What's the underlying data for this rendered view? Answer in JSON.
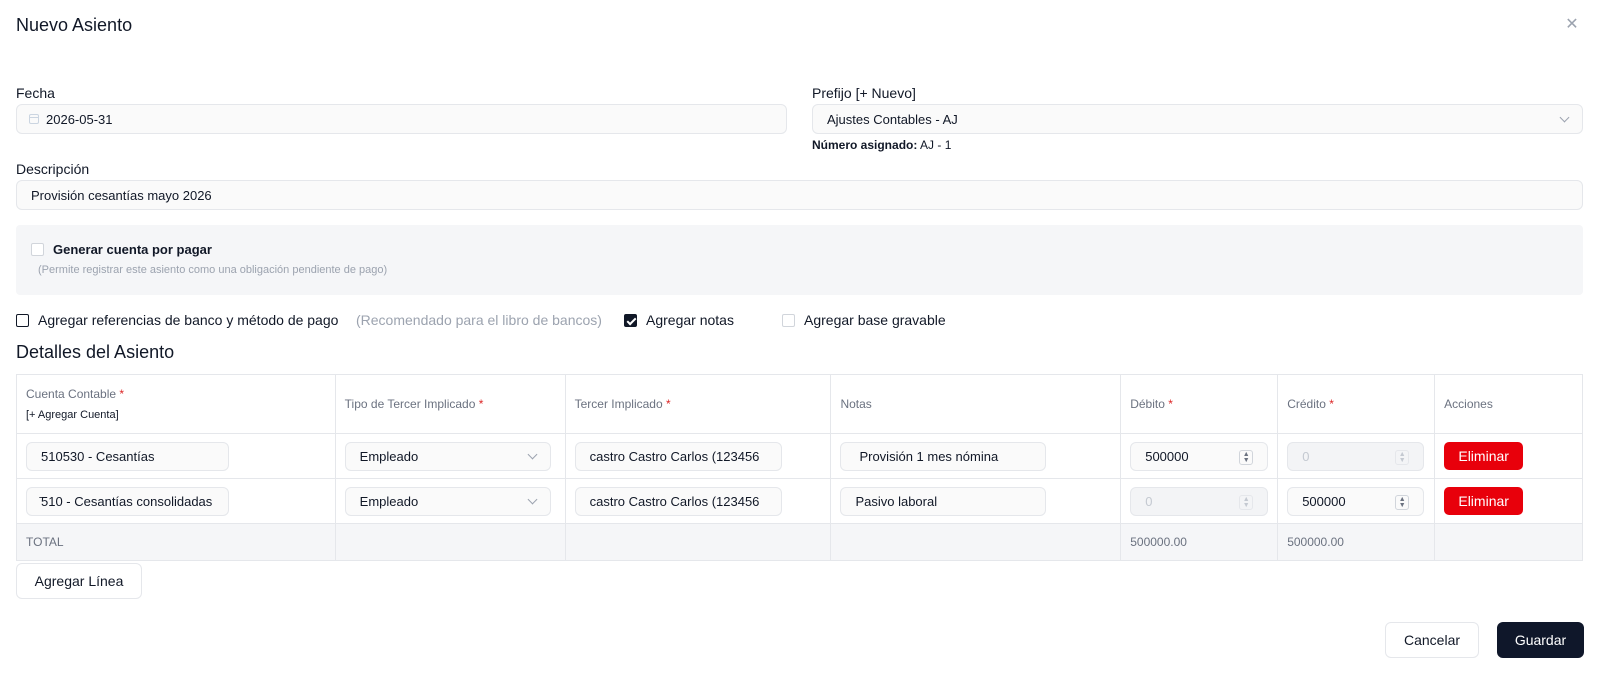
{
  "dialog": {
    "title": "Nuevo Asiento",
    "close_icon": "close-icon"
  },
  "form": {
    "fecha_label": "Fecha",
    "fecha_value": "2026-05-31",
    "prefijo_label": "Prefijo [+ Nuevo]",
    "prefijo_value": "Ajustes Contables - AJ",
    "numero_label": "Número asignado:",
    "numero_value": "AJ - 1",
    "descripcion_label": "Descripción",
    "descripcion_value": "Provisión cesantías mayo 2026"
  },
  "cuenta_por_pagar": {
    "label": "Generar cuenta por pagar",
    "hint": "(Permite registrar este asiento como una obligación pendiente de pago)",
    "checked": false
  },
  "options": [
    {
      "label": "Agregar referencias de banco y método de pago",
      "checked": false
    },
    {
      "note": "(Recomendado para el libro de bancos)"
    },
    {
      "label": "Agregar notas",
      "checked": true
    },
    {
      "label": "Agregar base gravable",
      "checked": false
    }
  ],
  "details": {
    "title": "Detalles del Asiento",
    "headers": {
      "cuenta": "Cuenta Contable",
      "cuenta_link": "[+ Agregar Cuenta]",
      "tipo": "Tipo de Tercer Implicado",
      "tercero": "Tercer Implicado",
      "notas": "Notas",
      "debito": "Débito",
      "credito": "Crédito",
      "acciones": "Acciones",
      "required_mark": "*"
    },
    "rows": [
      {
        "cuenta": "510530 - Cesantías",
        "tipo": "Empleado",
        "tercero": "castro Castro Carlos (123456",
        "notas": "Provisión 1 mes nómina",
        "debito": "500000",
        "credito": "0",
        "accion": "Eliminar"
      },
      {
        "cuenta": "̄510 - Cesantías consolidadas",
        "tipo": "Empleado",
        "tercero": "castro Castro Carlos (123456",
        "notas": "Pasivo laboral",
        "debito": "0",
        "credito": "500000",
        "accion": "Eliminar"
      }
    ],
    "total": {
      "label": "TOTAL",
      "debito": "500000.00",
      "credito": "500000.00"
    },
    "add_line": "Agregar Línea"
  },
  "footer": {
    "cancel": "Cancelar",
    "save": "Guardar"
  },
  "colors": {
    "danger": "#e8000b",
    "primary": "#0f172a",
    "panel_bg": "#f5f6f8"
  }
}
